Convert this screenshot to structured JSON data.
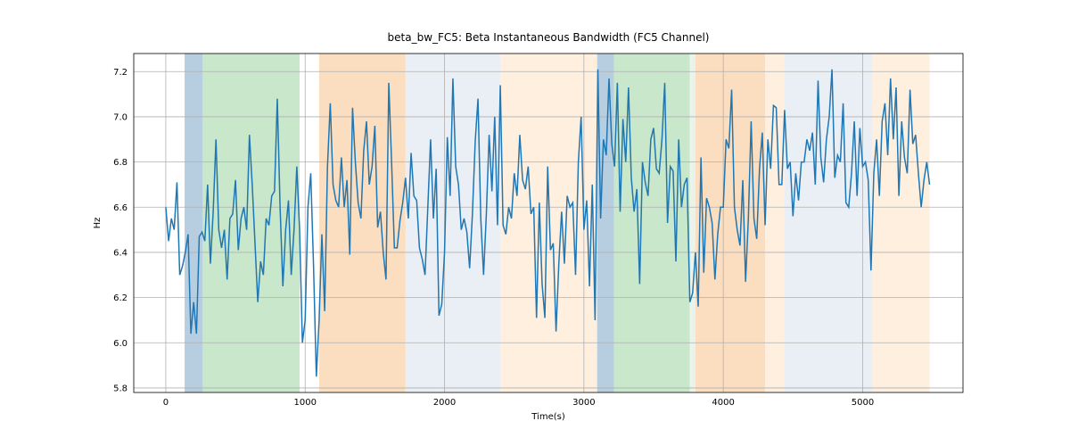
{
  "chart_data": {
    "type": "line",
    "title": "beta_bw_FC5: Beta Instantaneous Bandwidth (FC5 Channel)",
    "xlabel": "Time(s)",
    "ylabel": "Hz",
    "xlim": [
      -230,
      5720
    ],
    "ylim": [
      5.78,
      7.28
    ],
    "xticks": [
      0,
      1000,
      2000,
      3000,
      4000,
      5000
    ],
    "yticks": [
      5.8,
      6.0,
      6.2,
      6.4,
      6.6,
      6.8,
      7.0,
      7.2
    ],
    "bands": [
      {
        "x0": 135,
        "x1": 265,
        "color": "#b7cee1"
      },
      {
        "x0": 265,
        "x1": 960,
        "color": "#c9e7ca"
      },
      {
        "x0": 1100,
        "x1": 1720,
        "color": "#fbdebf"
      },
      {
        "x0": 1720,
        "x1": 1965,
        "color": "#eaeff6"
      },
      {
        "x0": 1965,
        "x1": 2400,
        "color": "#eaeff6"
      },
      {
        "x0": 2400,
        "x1": 3095,
        "color": "#feefdf"
      },
      {
        "x0": 3095,
        "x1": 3215,
        "color": "#b7cee1"
      },
      {
        "x0": 3215,
        "x1": 3760,
        "color": "#c9e7ca"
      },
      {
        "x0": 3760,
        "x1": 3800,
        "color": "#eaf4ea"
      },
      {
        "x0": 3800,
        "x1": 4300,
        "color": "#fbdebf"
      },
      {
        "x0": 4300,
        "x1": 4440,
        "color": "#feefdf"
      },
      {
        "x0": 4440,
        "x1": 5070,
        "color": "#eaeff6"
      },
      {
        "x0": 5070,
        "x1": 5480,
        "color": "#feefdf"
      }
    ],
    "series": [
      {
        "name": "beta_bw_FC5",
        "x": [
          0,
          20,
          40,
          60,
          80,
          100,
          120,
          140,
          160,
          180,
          200,
          220,
          240,
          260,
          280,
          300,
          320,
          340,
          360,
          380,
          400,
          420,
          440,
          460,
          480,
          500,
          520,
          540,
          560,
          580,
          600,
          620,
          640,
          660,
          680,
          700,
          720,
          740,
          760,
          780,
          800,
          820,
          840,
          860,
          880,
          900,
          920,
          940,
          960,
          980,
          1000,
          1020,
          1040,
          1060,
          1080,
          1100,
          1120,
          1140,
          1160,
          1180,
          1200,
          1220,
          1240,
          1260,
          1280,
          1300,
          1320,
          1340,
          1360,
          1380,
          1400,
          1420,
          1440,
          1460,
          1480,
          1500,
          1520,
          1540,
          1560,
          1580,
          1600,
          1620,
          1640,
          1660,
          1680,
          1700,
          1720,
          1740,
          1760,
          1780,
          1800,
          1820,
          1840,
          1860,
          1880,
          1900,
          1920,
          1940,
          1960,
          1980,
          2000,
          2020,
          2040,
          2060,
          2080,
          2100,
          2120,
          2140,
          2160,
          2180,
          2200,
          2220,
          2240,
          2260,
          2280,
          2300,
          2320,
          2340,
          2360,
          2380,
          2400,
          2420,
          2440,
          2460,
          2480,
          2500,
          2520,
          2540,
          2560,
          2580,
          2600,
          2620,
          2640,
          2660,
          2680,
          2700,
          2720,
          2740,
          2760,
          2780,
          2800,
          2820,
          2840,
          2860,
          2880,
          2900,
          2920,
          2940,
          2960,
          2980,
          3000,
          3020,
          3040,
          3060,
          3080,
          3100,
          3120,
          3140,
          3160,
          3180,
          3200,
          3220,
          3240,
          3260,
          3280,
          3300,
          3320,
          3340,
          3360,
          3380,
          3400,
          3420,
          3440,
          3460,
          3480,
          3500,
          3520,
          3540,
          3560,
          3580,
          3600,
          3620,
          3640,
          3660,
          3680,
          3700,
          3720,
          3740,
          3760,
          3780,
          3800,
          3820,
          3840,
          3860,
          3880,
          3900,
          3920,
          3940,
          3960,
          3980,
          4000,
          4020,
          4040,
          4060,
          4080,
          4100,
          4120,
          4140,
          4160,
          4180,
          4200,
          4220,
          4240,
          4260,
          4280,
          4300,
          4320,
          4340,
          4360,
          4380,
          4400,
          4420,
          4440,
          4460,
          4480,
          4500,
          4520,
          4540,
          4560,
          4580,
          4600,
          4620,
          4640,
          4660,
          4680,
          4700,
          4720,
          4740,
          4760,
          4780,
          4800,
          4820,
          4840,
          4860,
          4880,
          4900,
          4920,
          4940,
          4960,
          4980,
          5000,
          5020,
          5040,
          5060,
          5080,
          5100,
          5120,
          5140,
          5160,
          5180,
          5200,
          5220,
          5240,
          5260,
          5280,
          5300,
          5320,
          5340,
          5360,
          5380,
          5400,
          5420,
          5440,
          5460,
          5480
        ],
        "values": [
          6.6,
          6.45,
          6.55,
          6.5,
          6.71,
          6.3,
          6.34,
          6.4,
          6.48,
          6.04,
          6.18,
          6.04,
          6.47,
          6.49,
          6.45,
          6.7,
          6.35,
          6.58,
          6.9,
          6.5,
          6.42,
          6.5,
          6.28,
          6.55,
          6.57,
          6.72,
          6.41,
          6.55,
          6.6,
          6.5,
          6.92,
          6.7,
          6.44,
          6.18,
          6.36,
          6.3,
          6.55,
          6.52,
          6.65,
          6.67,
          7.08,
          6.6,
          6.25,
          6.5,
          6.63,
          6.3,
          6.5,
          6.78,
          6.5,
          6.0,
          6.1,
          6.6,
          6.75,
          6.34,
          5.85,
          6.1,
          6.48,
          6.14,
          6.78,
          7.06,
          6.7,
          6.63,
          6.6,
          6.82,
          6.6,
          6.72,
          6.39,
          7.04,
          6.8,
          6.62,
          6.55,
          6.85,
          6.98,
          6.7,
          6.78,
          6.96,
          6.51,
          6.58,
          6.4,
          6.28,
          7.15,
          6.8,
          6.42,
          6.42,
          6.54,
          6.62,
          6.73,
          6.55,
          6.84,
          6.65,
          6.63,
          6.42,
          6.37,
          6.3,
          6.6,
          6.9,
          6.55,
          6.77,
          6.12,
          6.17,
          6.4,
          6.91,
          6.65,
          7.17,
          6.78,
          6.7,
          6.5,
          6.55,
          6.49,
          6.33,
          6.57,
          6.89,
          7.08,
          6.55,
          6.3,
          6.57,
          6.92,
          6.67,
          7.0,
          6.52,
          7.14,
          6.52,
          6.48,
          6.6,
          6.55,
          6.75,
          6.65,
          6.92,
          6.72,
          6.68,
          6.78,
          6.57,
          6.6,
          6.11,
          6.62,
          6.26,
          6.11,
          6.78,
          6.41,
          6.44,
          6.05,
          6.35,
          6.58,
          6.35,
          6.65,
          6.6,
          6.62,
          6.3,
          6.8,
          7.0,
          6.5,
          6.63,
          6.25,
          6.7,
          6.1,
          7.21,
          6.55,
          6.9,
          6.83,
          7.17,
          6.88,
          6.78,
          7.15,
          6.58,
          6.99,
          6.8,
          7.13,
          6.73,
          6.58,
          6.68,
          6.26,
          6.8,
          6.71,
          6.65,
          6.9,
          6.95,
          6.77,
          6.75,
          6.9,
          7.15,
          6.53,
          6.78,
          6.76,
          6.36,
          6.9,
          6.6,
          6.7,
          6.73,
          6.18,
          6.22,
          6.4,
          6.16,
          6.82,
          6.31,
          6.64,
          6.6,
          6.53,
          6.28,
          6.48,
          6.6,
          6.6,
          6.9,
          6.86,
          7.12,
          6.6,
          6.5,
          6.43,
          6.72,
          6.27,
          6.55,
          6.98,
          6.55,
          6.46,
          6.77,
          6.93,
          6.52,
          6.9,
          6.77,
          7.05,
          7.04,
          6.7,
          6.7,
          7.03,
          6.77,
          6.8,
          6.56,
          6.75,
          6.63,
          6.8,
          6.8,
          6.9,
          6.85,
          6.93,
          6.7,
          7.16,
          6.82,
          6.71,
          6.9,
          7.0,
          7.21,
          6.73,
          6.83,
          6.8,
          7.06,
          6.62,
          6.6,
          6.75,
          6.98,
          6.65,
          6.95,
          6.78,
          6.8,
          6.72,
          6.32,
          6.75,
          6.9,
          6.65,
          6.98,
          7.06,
          6.83,
          7.17,
          6.9,
          7.13,
          6.65,
          6.98,
          6.82,
          6.75,
          7.12,
          6.88,
          6.92,
          6.75,
          6.6,
          6.72,
          6.8,
          6.7
        ]
      }
    ]
  }
}
